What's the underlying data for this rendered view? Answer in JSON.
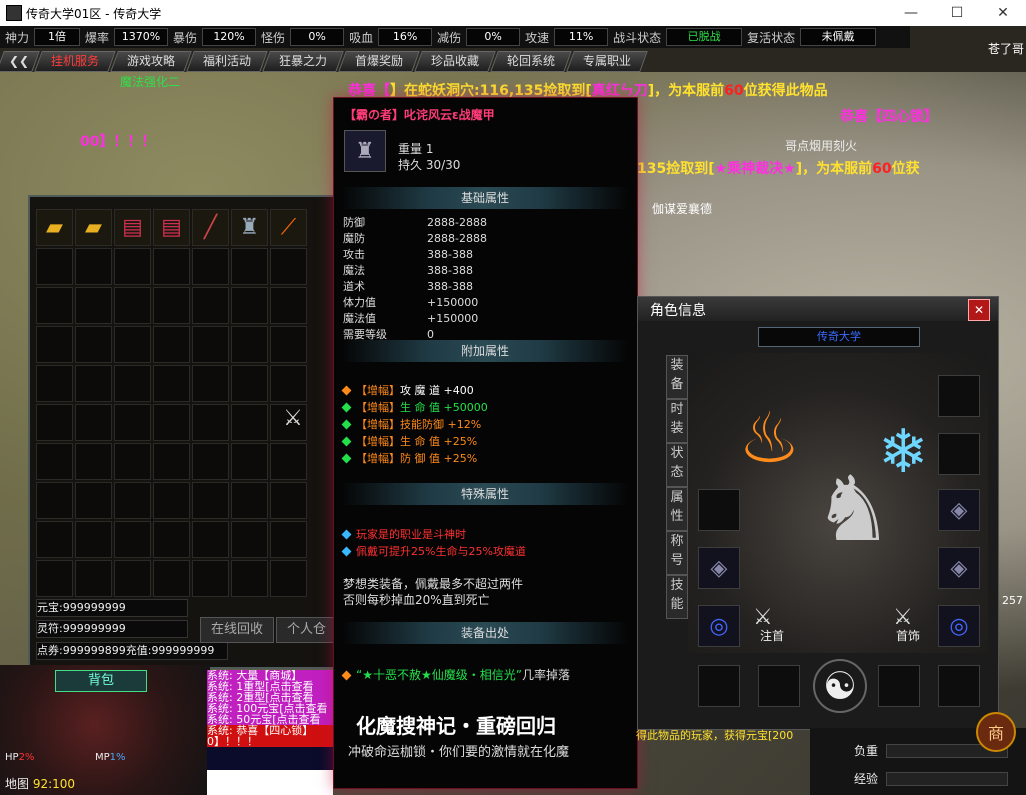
{
  "window": {
    "title": "传奇大学01区 - 传奇大学",
    "min": "—",
    "max": "☐",
    "close": "✕"
  },
  "stats": [
    {
      "label": "神力",
      "value": "1倍"
    },
    {
      "label": "爆率",
      "value": "1370%"
    },
    {
      "label": "暴伤",
      "value": "120%"
    },
    {
      "label": "怪伤",
      "value": "0%"
    },
    {
      "label": "吸血",
      "value": "16%"
    },
    {
      "label": "减伤",
      "value": "0%"
    },
    {
      "label": "攻速",
      "value": "11%"
    },
    {
      "label": "战斗状态",
      "value": "已脱战"
    },
    {
      "label": "复活状态",
      "value": "未佩戴"
    }
  ],
  "nav": {
    "back": "❮❮",
    "tabs": [
      "挂机服务",
      "游戏攻略",
      "福利活动",
      "狂暴之力",
      "首爆奖励",
      "珍品收藏",
      "轮回系统",
      "专属职业"
    ]
  },
  "world": {
    "npc1": "魔法强化二",
    "npc2": "哥点烟用刻火",
    "npc3": "伽谋爱襄德",
    "npc4": "苍了哥",
    "msg1a": "恭喜【",
    "msg1b": "】在蛇妖洞穴:116,135捡取到[",
    "msg1c": "真红ㄣ刀",
    "msg1d": "]，为本服前",
    "msg1e": "60",
    "msg1f": "位获得此物品",
    "msg2": "恭喜【四心锁】",
    "msg3": "00】！！！",
    "msg4a": "135捡取到[",
    "msg4b": "★乘神裁决★",
    "msg4c": "]，为本服前",
    "msg4d": "60",
    "msg4e": "位获",
    "right_num": "257"
  },
  "bag": {
    "yuanbao_label": "元宝:",
    "yuanbao": "999999999",
    "lingfu_label": "灵符:",
    "lingfu": "999999999",
    "dianquan_label": "点券:",
    "dianquan": "999999899",
    "chongzhi_label": "充值:",
    "chongzhi": "999999999",
    "btn_recycle": "在线回收",
    "btn_store": "个人仓库",
    "tab_label": "背包"
  },
  "tooltip": {
    "title": "【霸の者】叱诧风云ε战魔甲",
    "weight_label": "重量",
    "weight": "1",
    "durability_label": "持久",
    "durability": "30/30",
    "sec_base": "基础属性",
    "base": [
      {
        "k": "防御",
        "v": "2888-2888"
      },
      {
        "k": "魔防",
        "v": "2888-2888"
      },
      {
        "k": "攻击",
        "v": "388-388"
      },
      {
        "k": "魔法",
        "v": "388-388"
      },
      {
        "k": "道术",
        "v": "388-388"
      },
      {
        "k": "体力值",
        "v": "+150000"
      },
      {
        "k": "魔法值",
        "v": "+150000"
      },
      {
        "k": "需要等级",
        "v": "0"
      }
    ],
    "sec_extra": "附加属性",
    "extra": [
      {
        "tag": "【增幅】",
        "name": "攻 魔 道",
        "val": "+400",
        "color": "#ffffff",
        "bullet": "#ff8a1a"
      },
      {
        "tag": "【增幅】",
        "name": "生 命 值",
        "val": "+50000",
        "color": "#23e04a",
        "bullet": "#23e04a"
      },
      {
        "tag": "【增幅】",
        "name": "技能防御",
        "val": "+12%",
        "color": "#ff8a1a",
        "bullet": "#23e04a"
      },
      {
        "tag": "【增幅】",
        "name": "生 命 值",
        "val": "+25%",
        "color": "#ff8a1a",
        "bullet": "#23e04a"
      },
      {
        "tag": "【增幅】",
        "name": "防 御 值",
        "val": "+25%",
        "color": "#ff8a1a",
        "bullet": "#23e04a"
      }
    ],
    "sec_special": "特殊属性",
    "special1": "玩家是的职业是斗神时",
    "special2": "佩戴可提升25%生命与25%攻魔道",
    "note1": "梦想类装备，佩戴最多不超过两件",
    "note2": "否则每秒掉血20%直到死亡",
    "sec_source": "装备出处",
    "source_item": "“★十恶不赦★仙魔级・相信光”",
    "source_suffix": "几率掉落",
    "banner_title": "化魔搜神记・重磅回归",
    "banner_sub": "冲破命运枷锁・你们要的激情就在化魔"
  },
  "char": {
    "title": "角色信息",
    "close": "✕",
    "name": "传奇大学",
    "tabs": [
      "装备",
      "时装",
      "状态",
      "属性",
      "称号",
      "技能"
    ],
    "sword_left": "注首",
    "sword_right": "首饰"
  },
  "hud": {
    "hp_label": "HP",
    "hp": "2%",
    "mp_label": "MP",
    "mp": "1%",
    "map_label": "地图",
    "map": "92:100",
    "weight_label": "负重",
    "exp_label": "经验",
    "right_chat": "得此物品的玩家，获得元宝[200"
  },
  "chat": [
    "系统: 大量【商城】",
    "系统: 1重型[点击查看",
    "系统: 2重型[点击查看",
    "系统: 100元宝[点击查看",
    "系统: 50元宝[点击查看",
    "系统: 恭喜【四心锁】",
    "0】！！！"
  ]
}
